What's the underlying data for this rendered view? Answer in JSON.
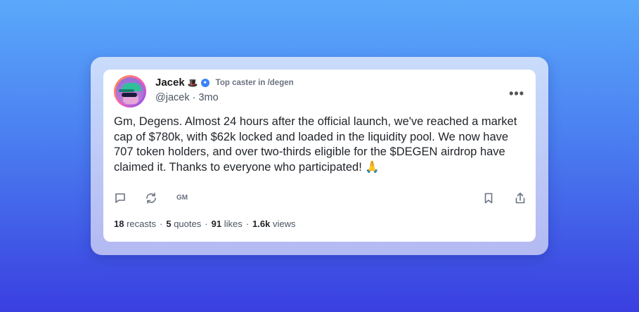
{
  "author": {
    "name": "Jacek",
    "emoji": "🎩",
    "caster_label": "Top caster in /degen",
    "handle": "@jacek",
    "time": "3mo"
  },
  "post": {
    "text": "Gm, Degens. Almost 24 hours after the official launch, we've reached a market cap of $780k, with $62k locked and loaded in the liquidity pool. We now have 707 token holders, and over two-thirds eligible for the $DEGEN airdrop have claimed it. Thanks to everyone who participated! 🙏"
  },
  "actions": {
    "gm_label": "GM"
  },
  "stats": {
    "recasts_count": "18",
    "recasts_label": "recasts",
    "quotes_count": "5",
    "quotes_label": "quotes",
    "likes_count": "91",
    "likes_label": "likes",
    "views_count": "1.6k",
    "views_label": "views"
  },
  "colors": {
    "verified": "#3b82f6",
    "muted": "#6b7280"
  }
}
